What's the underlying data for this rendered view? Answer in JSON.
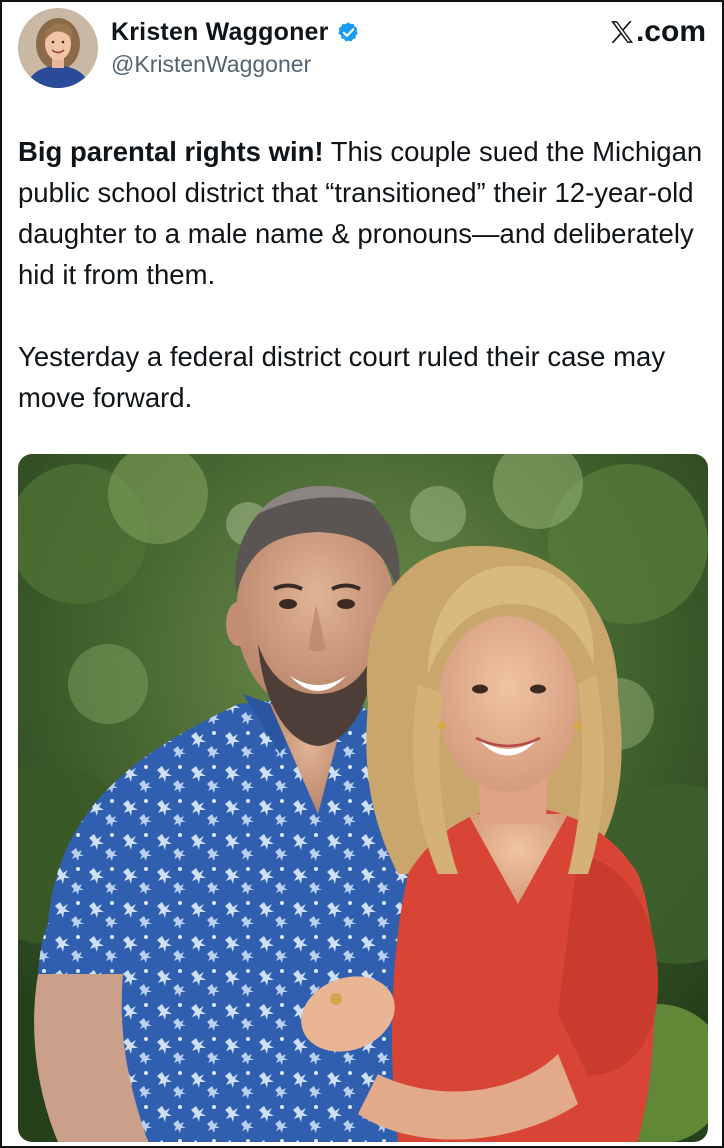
{
  "author": {
    "display_name": "Kristen Waggoner",
    "handle": "@KristenWaggoner",
    "verified_icon": "verified-badge-icon",
    "avatar_icon": "profile-avatar"
  },
  "brand": {
    "label": ".com",
    "icon": "x-logo-icon"
  },
  "tweet": {
    "bold_lead": "Big parental rights win!",
    "text_rest": " This couple sued the Michigan public school district that “transitioned” their 12-year-old daughter to a male name & pronouns—and deliberately hid it from them.",
    "paragraph_2": "Yesterday a federal district court ruled their case may move forward."
  },
  "media": {
    "type": "photo"
  },
  "colors": {
    "text": "#0f1419",
    "muted": "#536471",
    "verified_blue": "#1d9bf0",
    "frame_border": "#111111"
  }
}
